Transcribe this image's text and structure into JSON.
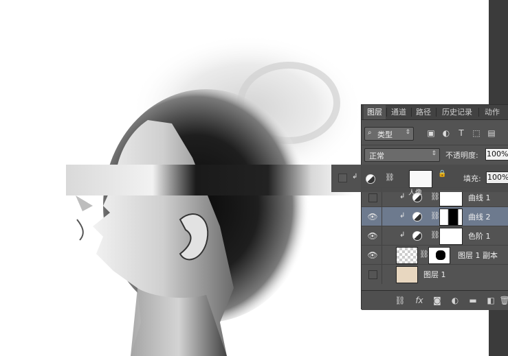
{
  "panel": {
    "tabs": [
      "图层",
      "通道",
      "路径",
      "历史记录",
      "动作"
    ],
    "active_tab": 0,
    "filter_kind": "类型",
    "blend_mode": "正常",
    "opacity_label": "不透明度:",
    "opacity_value": "100%",
    "fill_label": "填充:",
    "fill_value": "100%",
    "group_name": "人像"
  },
  "layers": [
    {
      "name": "曲线 1",
      "visible": false,
      "type": "curves",
      "selected": false
    },
    {
      "name": "曲线 2",
      "visible": true,
      "type": "curves",
      "selected": true
    },
    {
      "name": "色阶 1",
      "visible": true,
      "type": "levels",
      "selected": false
    },
    {
      "name": "图层 1 副本",
      "visible": true,
      "type": "pixel",
      "selected": false
    },
    {
      "name": "图层 1",
      "visible": false,
      "type": "pixel",
      "selected": false
    }
  ],
  "bottom_icons": [
    "link-icon",
    "fx-icon",
    "mask-icon",
    "adjustment-icon",
    "folder-icon",
    "new-layer-icon",
    "trash-icon"
  ],
  "colors": {
    "panel_bg": "#535353",
    "selected_row": "#6d7a8e",
    "tab_bar": "#424242"
  }
}
